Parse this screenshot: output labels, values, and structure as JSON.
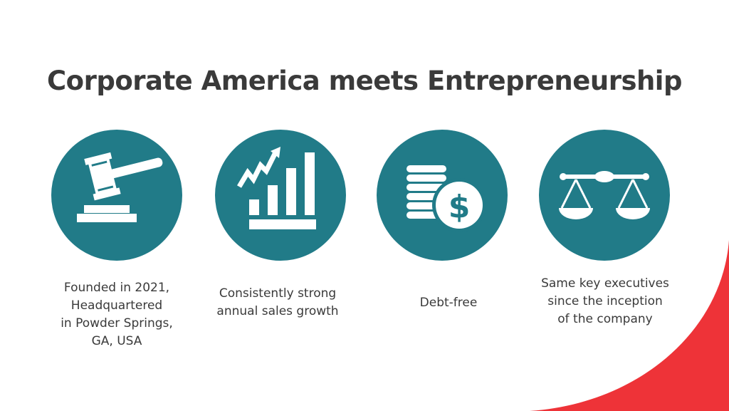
{
  "title": "Corporate America meets Entrepreneurship",
  "features": [
    {
      "icon": "gavel-icon",
      "lines": [
        "Founded in 2021,",
        "Headquartered",
        "in Powder Springs,",
        "GA, USA"
      ]
    },
    {
      "icon": "growth-chart-icon",
      "lines": [
        "Consistently strong",
        "annual sales growth"
      ]
    },
    {
      "icon": "coins-dollar-icon",
      "lines": [
        "Debt-free"
      ]
    },
    {
      "icon": "balance-scale-icon",
      "lines": [
        "Same key executives",
        "since the inception",
        "of the company"
      ]
    }
  ],
  "colors": {
    "circle": "#217b88",
    "accent": "#ee3338",
    "text": "#3a3a3a"
  }
}
